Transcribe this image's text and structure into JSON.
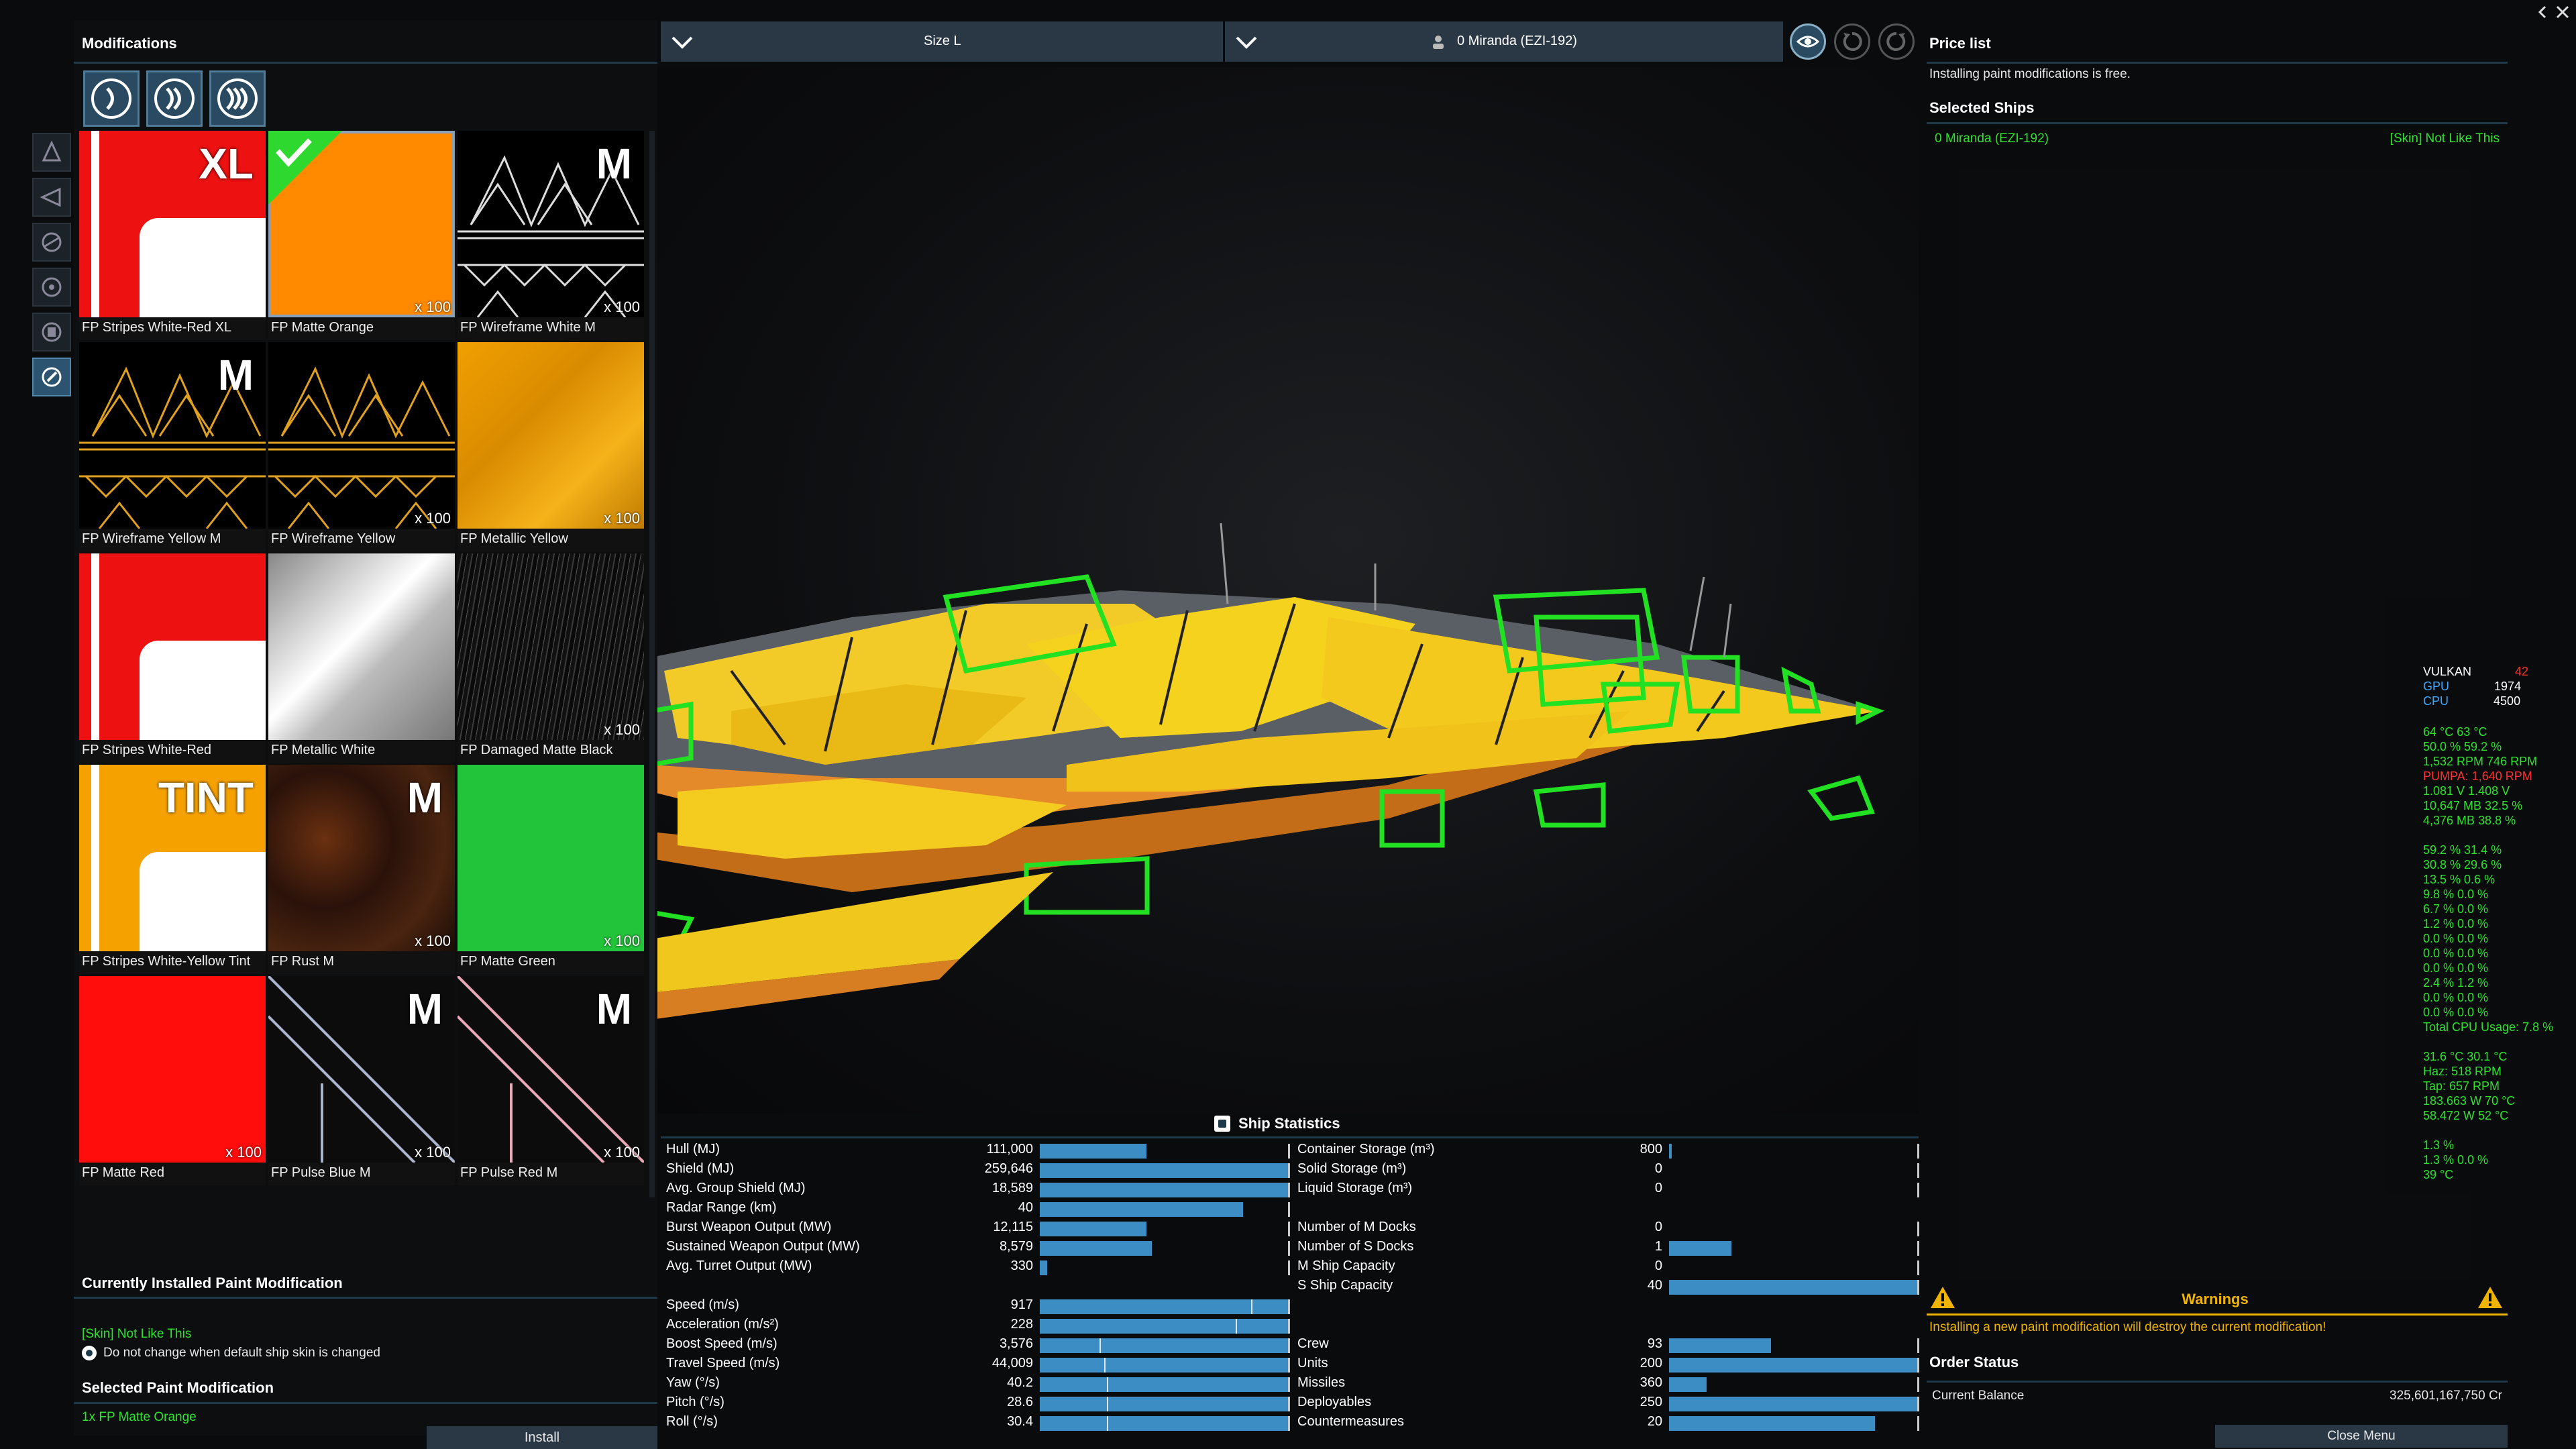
{
  "left": {
    "title": "Modifications",
    "tiers": [
      "tier-1",
      "tier-2",
      "tier-3"
    ],
    "side_icons": [
      "ship-up-icon",
      "ship-left-icon",
      "engine-icon",
      "turret-icon",
      "shield-icon",
      "paint-icon"
    ],
    "tiles": [
      {
        "name": "FP Stripes White-Red XL",
        "qty": "",
        "badge": "XL",
        "kind": "stripes-red"
      },
      {
        "name": "FP Matte Orange",
        "qty": "x 100",
        "badge": "",
        "kind": "orange"
      },
      {
        "name": "FP Wireframe White M",
        "qty": "x 100",
        "badge": "M",
        "kind": "wire-white"
      },
      {
        "name": "FP Wireframe Yellow M",
        "qty": "",
        "badge": "M",
        "kind": "wire-yellow"
      },
      {
        "name": "FP Wireframe Yellow",
        "qty": "x 100",
        "badge": "",
        "kind": "wire-yellow"
      },
      {
        "name": "FP Metallic Yellow",
        "qty": "x 100",
        "badge": "",
        "kind": "metal-yellow"
      },
      {
        "name": "FP Stripes White-Red",
        "qty": "",
        "badge": "",
        "kind": "stripes-red"
      },
      {
        "name": "FP Metallic White",
        "qty": "",
        "badge": "",
        "kind": "metal-white"
      },
      {
        "name": "FP Damaged Matte Black",
        "qty": "x 100",
        "badge": "",
        "kind": "damaged"
      },
      {
        "name": "FP Stripes White-Yellow Tint",
        "qty": "",
        "badge": "TINT",
        "kind": "stripes-yellow"
      },
      {
        "name": "FP Rust M",
        "qty": "x 100",
        "badge": "M",
        "kind": "rust"
      },
      {
        "name": "FP Matte Green",
        "qty": "x 100",
        "badge": "",
        "kind": "green"
      },
      {
        "name": "FP Matte Red",
        "qty": "x 100",
        "badge": "",
        "kind": "red"
      },
      {
        "name": "FP Pulse Blue M",
        "qty": "x 100",
        "badge": "M",
        "kind": "pulse-blue"
      },
      {
        "name": "FP Pulse Red M",
        "qty": "x 100",
        "badge": "M",
        "kind": "pulse-red"
      }
    ],
    "installed_title": "Currently Installed Paint Modification",
    "installed_value": "[Skin] Not Like This",
    "checkbox_label": "Do not change when default ship skin is changed",
    "selected_title": "Selected Paint Modification",
    "selected_value": "1x FP Matte Orange",
    "install_label": "Install"
  },
  "top": {
    "size_label": "Size L",
    "ship_label": "0 Miranda (EZI-192)"
  },
  "stats": {
    "title": "Ship Statistics",
    "left_rows": [
      {
        "label": "Hull (MJ)",
        "value": "111,000",
        "fill": 0.43
      },
      {
        "label": "Shield (MJ)",
        "value": "259,646",
        "fill": 1.0
      },
      {
        "label": "Avg. Group Shield (MJ)",
        "value": "18,589",
        "fill": 1.0
      },
      {
        "label": "Radar Range (km)",
        "value": "40",
        "fill": 0.82
      },
      {
        "label": "Burst Weapon Output (MW)",
        "value": "12,115",
        "fill": 0.43
      },
      {
        "label": "Sustained Weapon Output (MW)",
        "value": "8,579",
        "fill": 0.45
      },
      {
        "label": "Avg. Turret Output (MW)",
        "value": "330",
        "fill": 0.03
      },
      {
        "label": "",
        "value": "",
        "fill": -1
      },
      {
        "label": "Speed (m/s)",
        "value": "917",
        "fill": 1.0
      },
      {
        "label": "Acceleration (m/s²)",
        "value": "228",
        "fill": 1.0
      },
      {
        "label": "Boost Speed (m/s)",
        "value": "3,576",
        "fill": 1.0
      },
      {
        "label": "Travel Speed (m/s)",
        "value": "44,009",
        "fill": 1.0
      },
      {
        "label": "Yaw (°/s)",
        "value": "40.2",
        "fill": 1.0
      },
      {
        "label": "Pitch (°/s)",
        "value": "28.6",
        "fill": 1.0
      },
      {
        "label": "Roll (°/s)",
        "value": "30.4",
        "fill": 1.0
      }
    ],
    "right_rows": [
      {
        "label": "Container Storage (m³)",
        "value": "800",
        "fill": 0.01
      },
      {
        "label": "Solid Storage (m³)",
        "value": "0",
        "fill": 0
      },
      {
        "label": "Liquid Storage (m³)",
        "value": "0",
        "fill": 0
      },
      {
        "label": "",
        "value": "",
        "fill": -1
      },
      {
        "label": "Number of M Docks",
        "value": "0",
        "fill": 0
      },
      {
        "label": "Number of S Docks",
        "value": "1",
        "fill": 0.25
      },
      {
        "label": "M Ship Capacity",
        "value": "0",
        "fill": 0
      },
      {
        "label": "S Ship Capacity",
        "value": "40",
        "fill": 1.0
      },
      {
        "label": "",
        "value": "",
        "fill": -1
      },
      {
        "label": "",
        "value": "",
        "fill": -1
      },
      {
        "label": "Crew",
        "value": "93",
        "fill": 0.41
      },
      {
        "label": "Units",
        "value": "200",
        "fill": 1.0
      },
      {
        "label": "Missiles",
        "value": "360",
        "fill": 0.15
      },
      {
        "label": "Deployables",
        "value": "250",
        "fill": 1.0
      },
      {
        "label": "Countermeasures",
        "value": "20",
        "fill": 0.83
      }
    ]
  },
  "right": {
    "price_title": "Price list",
    "price_text": "Installing paint modifications is free.",
    "selected_ships_title": "Selected Ships",
    "ship_name": "0 Miranda (EZI-192)",
    "ship_skin": "[Skin] Not Like This",
    "warnings_title": "Warnings",
    "warning_text": "Installing a new paint modification will destroy the current modification!",
    "order_title": "Order Status",
    "balance_label": "Current Balance",
    "balance_value": "325,601,167,750 Cr",
    "close_label": "Close Menu"
  },
  "hw": {
    "vulkan": "VULKAN",
    "vulkan_val": "42",
    "gpu": "GPU",
    "gpu_val": "1974",
    "cpu": "CPU",
    "cpu_val": "4500",
    "lines_green": [
      "64 °C 63 °C",
      "50.0 % 59.2 %",
      "1,532 RPM 746 RPM"
    ],
    "pumpa": "PUMPA: 1,640 RPM",
    "lines_green2": [
      "1.081 V 1.408 V",
      "10,647 MB 32.5 %",
      "4,376 MB 38.8 %"
    ],
    "cpu_lines": [
      "59.2 % 31.4 %",
      "30.8 % 29.6 %",
      "13.5 % 0.6 %",
      "9.8 % 0.0 %",
      "6.7 % 0.0 %",
      "1.2 % 0.0 %",
      "0.0 % 0.0 %",
      "0.0 % 0.0 %",
      "0.0 % 0.0 %",
      "2.4 % 1.2 %",
      "0.0 % 0.0 %",
      "0.0 % 0.0 %",
      "Total CPU Usage: 7.8 %"
    ],
    "sys_lines": [
      "31.6 °C 30.1 °C",
      "Haz: 518 RPM",
      "Tap: 657 RPM",
      "183.663 W 70 °C",
      "58.472 W 52 °C"
    ],
    "tail_lines": [
      "1.3 %",
      "1.3 % 0.0 %",
      "39 °C"
    ]
  },
  "colors": {
    "accent": "#3c8dc4",
    "green": "#2ee22e",
    "warning": "#f0b400",
    "panel": "#2a3845"
  }
}
